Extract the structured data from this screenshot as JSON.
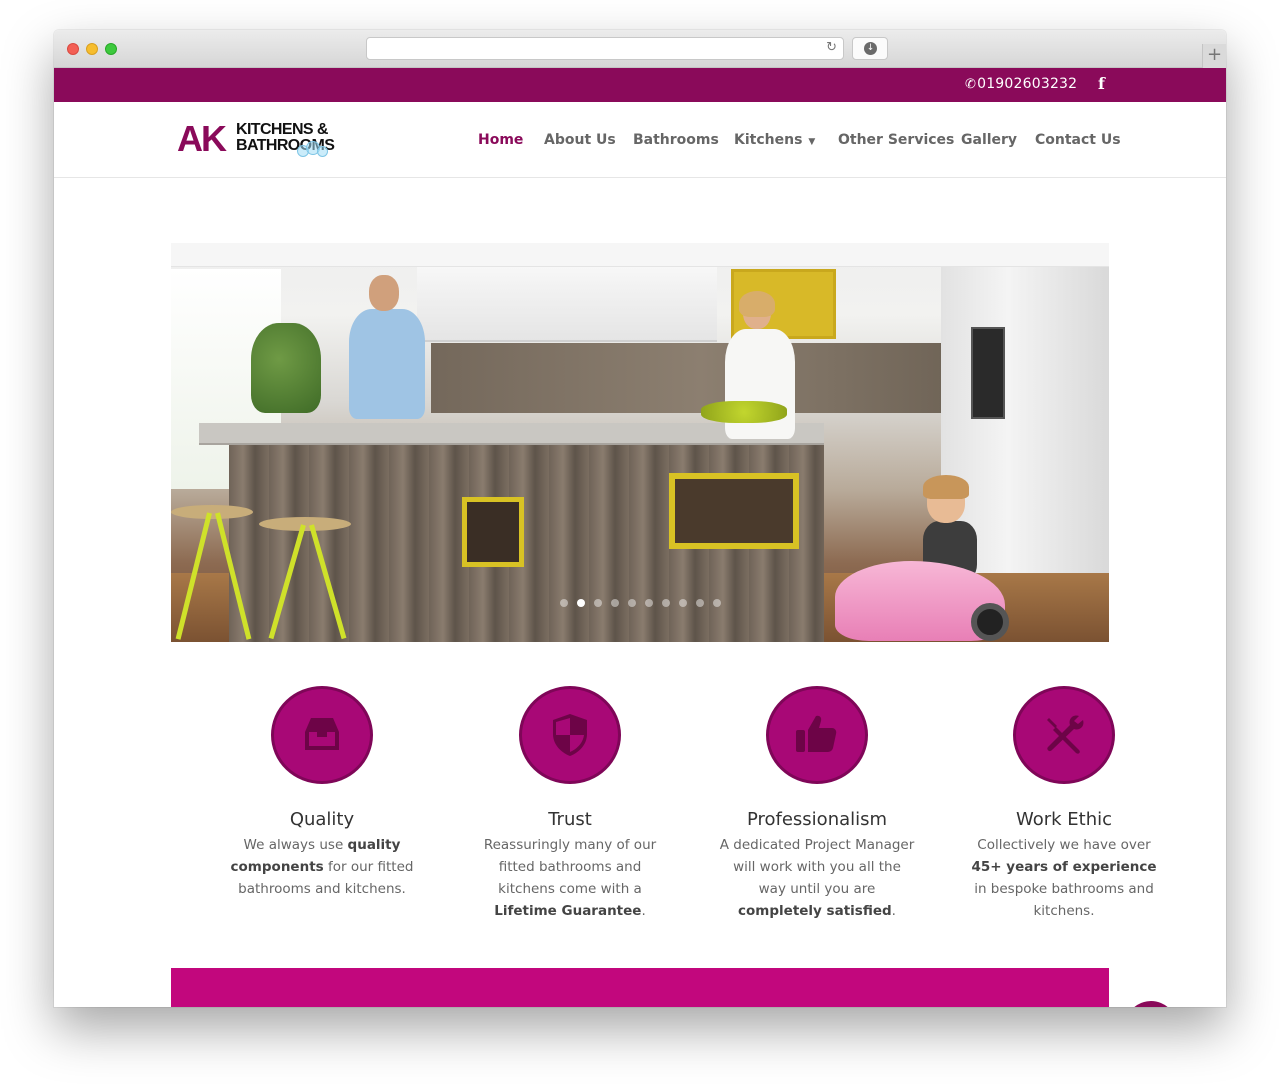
{
  "browser": {
    "address_url": "",
    "newtab_label": "+"
  },
  "topbar": {
    "phone": "01902603232",
    "facebook_icon": "f",
    "colors": {
      "bar": "#8a0a5a"
    }
  },
  "logo": {
    "mark": "AK",
    "line1": "KITCHENS &",
    "line2": "BATHROOMS"
  },
  "nav": {
    "items": [
      {
        "label": "Home",
        "active": true
      },
      {
        "label": "About Us"
      },
      {
        "label": "Bathrooms"
      },
      {
        "label": "Kitchens",
        "has_dropdown": true
      },
      {
        "label": "Other Services"
      },
      {
        "label": "Gallery"
      },
      {
        "label": "Contact Us"
      }
    ],
    "active_color": "#8a0a5a"
  },
  "slider": {
    "slide_count": 10,
    "active_index": 1
  },
  "features": [
    {
      "icon": "inbox-tray-icon",
      "title": "Quality",
      "text_parts": [
        "We always use ",
        "quality components",
        " for our fitted bathrooms and kitchens."
      ]
    },
    {
      "icon": "shield-icon",
      "title": "Trust",
      "text_parts": [
        "Reassuringly many of our fitted bathrooms and kitchens come with a ",
        "Lifetime Guarantee",
        "."
      ]
    },
    {
      "icon": "thumbs-up-icon",
      "title": "Professionalism",
      "text_parts": [
        "A dedicated Project Manager will work with you all the way until you are ",
        "completely satisfied",
        "."
      ]
    },
    {
      "icon": "wrench-screwdriver-icon",
      "title": "Work Ethic",
      "text_parts": [
        "Collectively we have over ",
        "45+ years of experience",
        " in bespoke bathrooms and kitchens."
      ]
    }
  ],
  "colors": {
    "accent": "#8a0a5a",
    "feature_circle": "#a80876",
    "cta_band": "#c2077d"
  }
}
